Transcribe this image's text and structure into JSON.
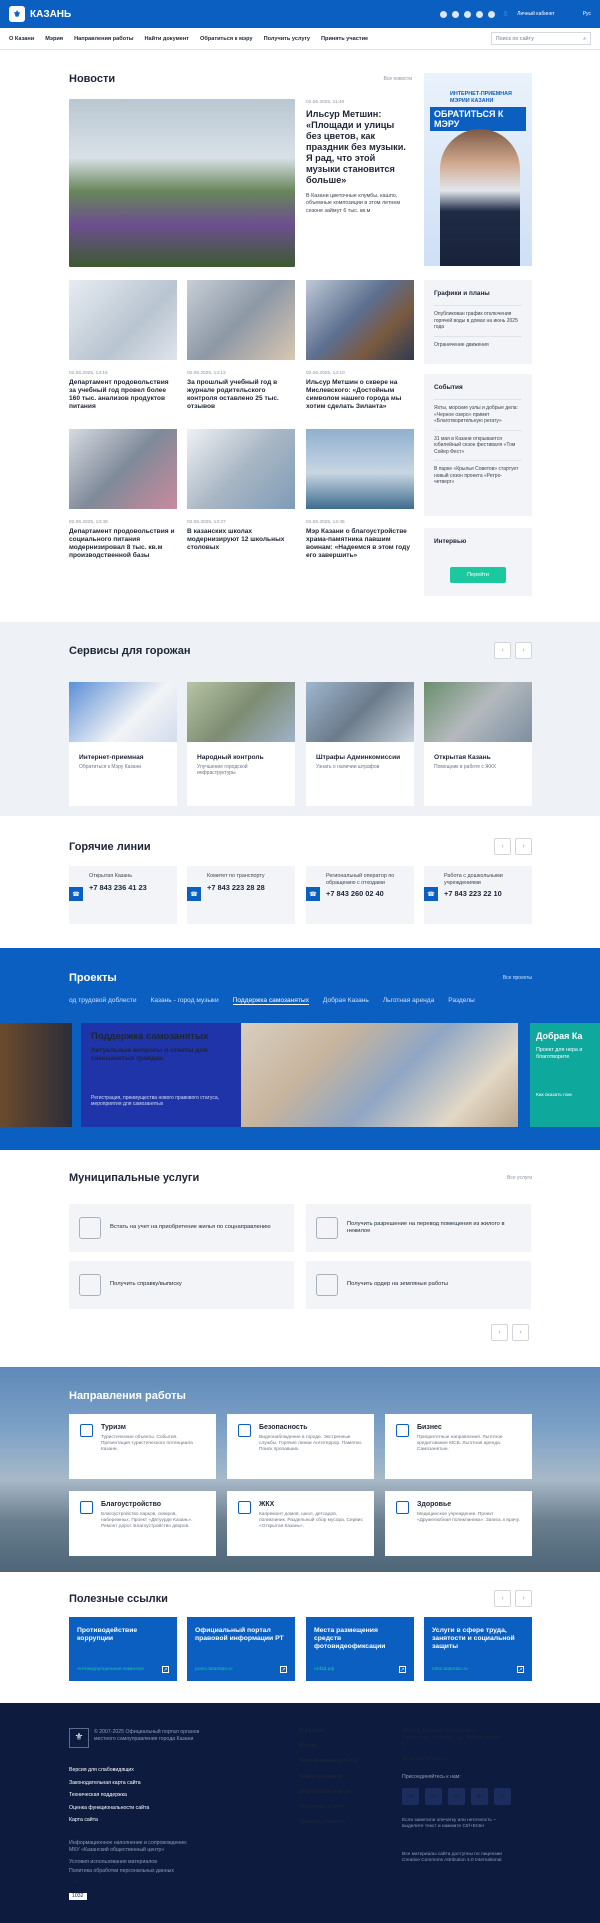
{
  "header": {
    "brand": "КАЗАНЬ",
    "logo_glyph": "⚜",
    "cabinet": "Личный кабинет",
    "lang": "Рус"
  },
  "nav": {
    "items": [
      "О Казани",
      "Мэрия",
      "Направления работы",
      "Найти документ",
      "Обратиться к мэру",
      "Получить услугу",
      "Принять участие"
    ],
    "search_placeholder": "Поиск по сайту"
  },
  "news": {
    "title": "Новости",
    "all": "Все новости",
    "big": {
      "date": "02.06.2025, 11:40",
      "title": "Ильсур Метшин: «Площади и улицы без цветов, как праздник без музыки. Я рад, что этой музыки становится больше»",
      "text": "В Казани цветочные клумбы, кашпо, объемные композиции в этом летнем сезоне займут 6 тыс. кв.м"
    },
    "cards": [
      {
        "date": "02.06.2025, 14:16",
        "title": "Департамент продовольствия за учебный год провел более 160 тыс. анализов продуктов питания"
      },
      {
        "date": "02.06.2025, 14:13",
        "title": "За прошлый учебный год в журнале родительского контроля оставлено 25 тыс. отзывов"
      },
      {
        "date": "02.06.2025, 14:10",
        "title": "Ильсур Метшин о сквере на Мислевского: «Достойным символом нашего города мы хотим сделать Зиланта»"
      },
      {
        "date": "02.06.2025, 13:48",
        "title": "Департамент продовольствия и социального питания модернизировал 8 тыс. кв.м производственной базы"
      },
      {
        "date": "02.06.2025, 13:27",
        "title": "В казанских школах модернизируют 12 школьных столовых"
      },
      {
        "date": "02.06.2025, 12:45",
        "title": "Мэр Казани о благоустройстве храма-памятника павшим воинам: «Надеемся в этом году его завершить»"
      }
    ]
  },
  "mayor_ad": {
    "label": "ИНТЕРНЕТ-ПРИЕМНАЯ МЭРИИ КАЗАНИ",
    "cta": "ОБРАТИТЬСЯ К МЭРУ"
  },
  "sidebar": {
    "schedules": {
      "title": "Графики и планы",
      "items": [
        "Опубликован график отключения горячей воды в домах на июнь 2025 года",
        "Ограничение движения"
      ]
    },
    "events": {
      "title": "События",
      "items": [
        "Яхты, морские узлы и добрые дела: «Черное озеро» примет «Благотворительную регату»",
        "31 мая в Казани открывается юбилейный сезон фестиваля «Том Сойер Фест»",
        "В парке «Крылья Советов» стартует новый сезон проекта «Ретро-четверг»"
      ]
    },
    "interview": {
      "title": "Интервью",
      "button": "Перейти"
    }
  },
  "services": {
    "title": "Сервисы для горожан",
    "items": [
      {
        "title": "Интернет-приемная",
        "sub": "Обратиться к Мэру Казани"
      },
      {
        "title": "Народный контроль",
        "sub": "Улучшение городской инфраструктуры"
      },
      {
        "title": "Штрафы Админкомиссии",
        "sub": "Узнать о наличии штрафов"
      },
      {
        "title": "Открытая Казань",
        "sub": "Помощник в работе с ЖКХ"
      }
    ]
  },
  "hotlines": {
    "title": "Горячие линии",
    "items": [
      {
        "name": "Открытая Казань",
        "phone": "+7 843 236 41 23"
      },
      {
        "name": "Комитет по транспорту",
        "phone": "+7 843 223 28 28"
      },
      {
        "name": "Региональный оператор по обращению с отходами",
        "phone": "+7 843 260 02 40"
      },
      {
        "name": "Работа с дошкольными учреждениями",
        "phone": "+7 843 223 22 10"
      }
    ]
  },
  "projects": {
    "title": "Проекты",
    "all": "Все проекты",
    "tabs": [
      "од трудовой доблести",
      "Казань - город музыки",
      "Поддержка самозанятых",
      "Добрая Казань",
      "Льготная аренда",
      "Разделы"
    ],
    "card": {
      "title": "Поддержка самозанятых",
      "sub": "Актуальные вопросы и ответы для самозанятых граждан",
      "text": "Регистрация, преимущества нового правового статуса, мероприятия для самозанятых"
    },
    "next": {
      "title": "Добрая Ка",
      "sub": "Проект для нера и благотворите",
      "link": "Как оказать пом"
    }
  },
  "municipal": {
    "title": "Муниципальные услуги",
    "all": "Все услуги",
    "items": [
      "Встать на учет на приобретение жилья по соцнаправлению",
      "Получить разрешение на перевод помещения из жилого в нежилое",
      "Получить справку/выписку",
      "Получить ордер на земляные работы"
    ]
  },
  "directions": {
    "title": "Направления работы",
    "items": [
      {
        "title": "Туризм",
        "sub": "Туристические объекты. События. Презентация туристического потенциала Казани."
      },
      {
        "title": "Безопасность",
        "sub": "Видеонаблюдение в городе. Экстренные службы. Горячие линии Антитеррор. Памятки. Поиск пропавших."
      },
      {
        "title": "Бизнес",
        "sub": "Приоритетные направления. Льготное кредитование МСБ. Льготная аренда. Самозанятые."
      },
      {
        "title": "Благоустройство",
        "sub": "Благоустройство парков, скверов, набережных. Проект «Двтуурде Казань». Ремонт дорог. Благоустройство дворов."
      },
      {
        "title": "ЖКХ",
        "sub": "Капремонт домов, школ, детсадов, поликлиник. Раздельный сбор мусора. Сервис «Открытая Казань»."
      },
      {
        "title": "Здоровье",
        "sub": "Медицинское учреждение. Проект «Дружелюбная поликлиника». Запись к врачу."
      }
    ]
  },
  "links": {
    "title": "Полезные ссылки",
    "items": [
      {
        "title": "Противодействие коррупции",
        "url": "Антикоррупционная комиссия"
      },
      {
        "title": "Официальный портал правовой информации РТ",
        "url": "pravo.tatarstan.ru"
      },
      {
        "title": "Места размещения средств фотовидеофиксации",
        "url": "rmfdd.рф"
      },
      {
        "title": "Услуги в сфере труда, занятости и социальной защиты",
        "url": "mtsz.tatarstan.ru"
      }
    ]
  },
  "footer": {
    "copyright": "© 2007-2025 Официальный портал органов местного самоуправления города Казани",
    "left_links": [
      "Версия для слабовидящих",
      "Законодательная карта сайта",
      "Техническая поддержка",
      "Оценка функциональности сайта",
      "Карта сайта"
    ],
    "note": "Информационное наполнение и сопровождение: МКУ «Казанский общественный центр»",
    "terms": [
      "Условия использования материалов",
      "Политика обработки персональных данных"
    ],
    "age": "12+",
    "counter": "1032",
    "menu": [
      "О Казани",
      "Мэрия",
      "Направления работы",
      "Найти документ",
      "Обратиться к мэру",
      "Получить услугу",
      "Принять участие"
    ],
    "address": "420111, Россия, Республика Татарстан, г. Казань, ул. Кремлевская, 3",
    "email": "rik.kazan@tatar.ru",
    "join": "Присоединяйтесь к нам:",
    "errors": "Если заметили опечатку или неточность – выделите текст и нажмите Ctrl+Enter",
    "license": "Все материалы сайта доступны по лицензии Creative Commons Attribution 4.0 International",
    "social": [
      "vk",
      "ok",
      "ig",
      "yt",
      "tg"
    ]
  },
  "colors": {
    "brand": "#0b5fc1",
    "accent": "#1bc8a0",
    "footer": "#0d1b3f"
  }
}
